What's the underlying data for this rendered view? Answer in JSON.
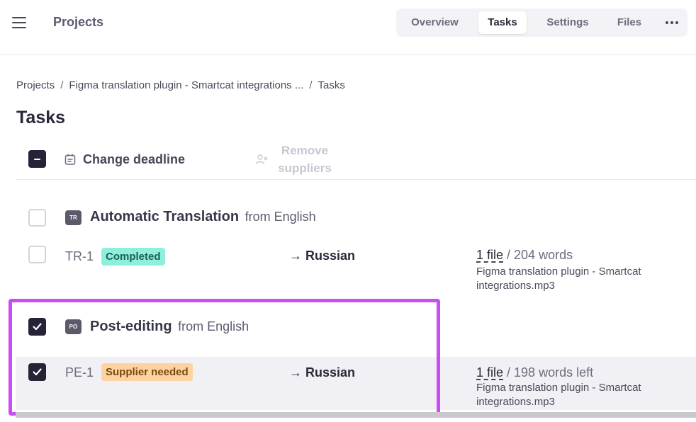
{
  "header": {
    "app_title": "Projects",
    "tabs": [
      {
        "label": "Overview",
        "active": false
      },
      {
        "label": "Tasks",
        "active": true
      },
      {
        "label": "Settings",
        "active": false
      },
      {
        "label": "Files",
        "active": false
      }
    ]
  },
  "breadcrumb": {
    "items": [
      "Projects",
      "Figma translation plugin - Smartcat integrations ...",
      "Tasks"
    ],
    "separator": "/"
  },
  "page": {
    "title": "Tasks"
  },
  "toolbar": {
    "change_deadline": "Change deadline",
    "remove_suppliers_line1": "Remove",
    "remove_suppliers_line2": "suppliers"
  },
  "groups": [
    {
      "icon_text": "TR",
      "name": "Automatic Translation",
      "from": "from English",
      "checked": false,
      "tasks": [
        {
          "id": "TR-1",
          "status": "Completed",
          "target": "→ Russian",
          "file_link": "1 file",
          "words": " / 204 words",
          "file_name": "Figma translation plugin - Smartcat integrations.mp3",
          "checked": false
        }
      ]
    },
    {
      "icon_text": "PO",
      "name": "Post-editing",
      "from": "from English",
      "checked": true,
      "tasks": [
        {
          "id": "PE-1",
          "status": "Supplier needed",
          "target": "→ Russian",
          "file_link": "1 file",
          "words": " / 198 words left",
          "file_name": "Figma translation plugin - Smartcat integrations.mp3",
          "checked": true
        }
      ]
    }
  ],
  "colors": {
    "highlight_border": "#c84df5",
    "badge_completed": "#8ef0dc",
    "badge_supplier_needed": "#fdd4a0",
    "checkbox_checked": "#262237"
  }
}
